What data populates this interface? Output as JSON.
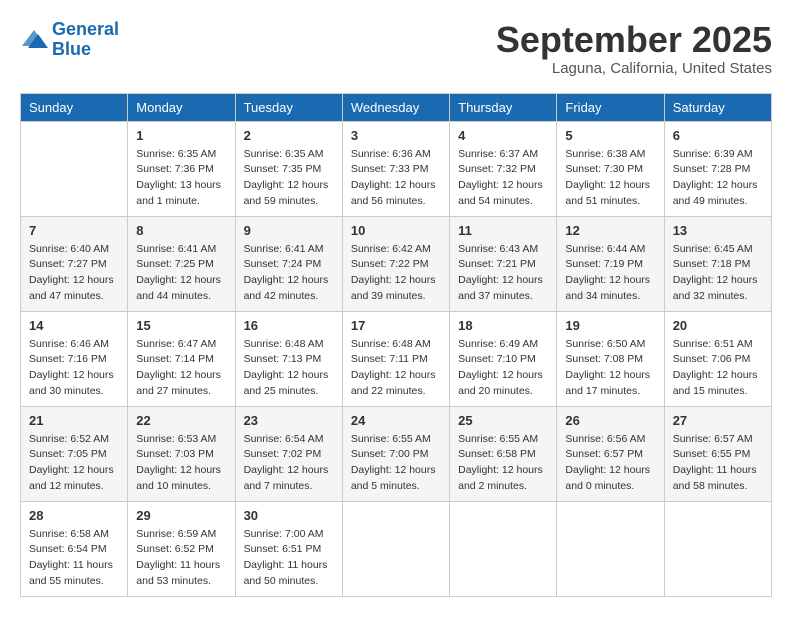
{
  "header": {
    "logo_line1": "General",
    "logo_line2": "Blue",
    "month_title": "September 2025",
    "location": "Laguna, California, United States"
  },
  "days_of_week": [
    "Sunday",
    "Monday",
    "Tuesday",
    "Wednesday",
    "Thursday",
    "Friday",
    "Saturday"
  ],
  "weeks": [
    [
      {
        "day": "",
        "sunrise": "",
        "sunset": "",
        "daylight": ""
      },
      {
        "day": "1",
        "sunrise": "Sunrise: 6:35 AM",
        "sunset": "Sunset: 7:36 PM",
        "daylight": "Daylight: 13 hours and 1 minute."
      },
      {
        "day": "2",
        "sunrise": "Sunrise: 6:35 AM",
        "sunset": "Sunset: 7:35 PM",
        "daylight": "Daylight: 12 hours and 59 minutes."
      },
      {
        "day": "3",
        "sunrise": "Sunrise: 6:36 AM",
        "sunset": "Sunset: 7:33 PM",
        "daylight": "Daylight: 12 hours and 56 minutes."
      },
      {
        "day": "4",
        "sunrise": "Sunrise: 6:37 AM",
        "sunset": "Sunset: 7:32 PM",
        "daylight": "Daylight: 12 hours and 54 minutes."
      },
      {
        "day": "5",
        "sunrise": "Sunrise: 6:38 AM",
        "sunset": "Sunset: 7:30 PM",
        "daylight": "Daylight: 12 hours and 51 minutes."
      },
      {
        "day": "6",
        "sunrise": "Sunrise: 6:39 AM",
        "sunset": "Sunset: 7:28 PM",
        "daylight": "Daylight: 12 hours and 49 minutes."
      }
    ],
    [
      {
        "day": "7",
        "sunrise": "Sunrise: 6:40 AM",
        "sunset": "Sunset: 7:27 PM",
        "daylight": "Daylight: 12 hours and 47 minutes."
      },
      {
        "day": "8",
        "sunrise": "Sunrise: 6:41 AM",
        "sunset": "Sunset: 7:25 PM",
        "daylight": "Daylight: 12 hours and 44 minutes."
      },
      {
        "day": "9",
        "sunrise": "Sunrise: 6:41 AM",
        "sunset": "Sunset: 7:24 PM",
        "daylight": "Daylight: 12 hours and 42 minutes."
      },
      {
        "day": "10",
        "sunrise": "Sunrise: 6:42 AM",
        "sunset": "Sunset: 7:22 PM",
        "daylight": "Daylight: 12 hours and 39 minutes."
      },
      {
        "day": "11",
        "sunrise": "Sunrise: 6:43 AM",
        "sunset": "Sunset: 7:21 PM",
        "daylight": "Daylight: 12 hours and 37 minutes."
      },
      {
        "day": "12",
        "sunrise": "Sunrise: 6:44 AM",
        "sunset": "Sunset: 7:19 PM",
        "daylight": "Daylight: 12 hours and 34 minutes."
      },
      {
        "day": "13",
        "sunrise": "Sunrise: 6:45 AM",
        "sunset": "Sunset: 7:18 PM",
        "daylight": "Daylight: 12 hours and 32 minutes."
      }
    ],
    [
      {
        "day": "14",
        "sunrise": "Sunrise: 6:46 AM",
        "sunset": "Sunset: 7:16 PM",
        "daylight": "Daylight: 12 hours and 30 minutes."
      },
      {
        "day": "15",
        "sunrise": "Sunrise: 6:47 AM",
        "sunset": "Sunset: 7:14 PM",
        "daylight": "Daylight: 12 hours and 27 minutes."
      },
      {
        "day": "16",
        "sunrise": "Sunrise: 6:48 AM",
        "sunset": "Sunset: 7:13 PM",
        "daylight": "Daylight: 12 hours and 25 minutes."
      },
      {
        "day": "17",
        "sunrise": "Sunrise: 6:48 AM",
        "sunset": "Sunset: 7:11 PM",
        "daylight": "Daylight: 12 hours and 22 minutes."
      },
      {
        "day": "18",
        "sunrise": "Sunrise: 6:49 AM",
        "sunset": "Sunset: 7:10 PM",
        "daylight": "Daylight: 12 hours and 20 minutes."
      },
      {
        "day": "19",
        "sunrise": "Sunrise: 6:50 AM",
        "sunset": "Sunset: 7:08 PM",
        "daylight": "Daylight: 12 hours and 17 minutes."
      },
      {
        "day": "20",
        "sunrise": "Sunrise: 6:51 AM",
        "sunset": "Sunset: 7:06 PM",
        "daylight": "Daylight: 12 hours and 15 minutes."
      }
    ],
    [
      {
        "day": "21",
        "sunrise": "Sunrise: 6:52 AM",
        "sunset": "Sunset: 7:05 PM",
        "daylight": "Daylight: 12 hours and 12 minutes."
      },
      {
        "day": "22",
        "sunrise": "Sunrise: 6:53 AM",
        "sunset": "Sunset: 7:03 PM",
        "daylight": "Daylight: 12 hours and 10 minutes."
      },
      {
        "day": "23",
        "sunrise": "Sunrise: 6:54 AM",
        "sunset": "Sunset: 7:02 PM",
        "daylight": "Daylight: 12 hours and 7 minutes."
      },
      {
        "day": "24",
        "sunrise": "Sunrise: 6:55 AM",
        "sunset": "Sunset: 7:00 PM",
        "daylight": "Daylight: 12 hours and 5 minutes."
      },
      {
        "day": "25",
        "sunrise": "Sunrise: 6:55 AM",
        "sunset": "Sunset: 6:58 PM",
        "daylight": "Daylight: 12 hours and 2 minutes."
      },
      {
        "day": "26",
        "sunrise": "Sunrise: 6:56 AM",
        "sunset": "Sunset: 6:57 PM",
        "daylight": "Daylight: 12 hours and 0 minutes."
      },
      {
        "day": "27",
        "sunrise": "Sunrise: 6:57 AM",
        "sunset": "Sunset: 6:55 PM",
        "daylight": "Daylight: 11 hours and 58 minutes."
      }
    ],
    [
      {
        "day": "28",
        "sunrise": "Sunrise: 6:58 AM",
        "sunset": "Sunset: 6:54 PM",
        "daylight": "Daylight: 11 hours and 55 minutes."
      },
      {
        "day": "29",
        "sunrise": "Sunrise: 6:59 AM",
        "sunset": "Sunset: 6:52 PM",
        "daylight": "Daylight: 11 hours and 53 minutes."
      },
      {
        "day": "30",
        "sunrise": "Sunrise: 7:00 AM",
        "sunset": "Sunset: 6:51 PM",
        "daylight": "Daylight: 11 hours and 50 minutes."
      },
      {
        "day": "",
        "sunrise": "",
        "sunset": "",
        "daylight": ""
      },
      {
        "day": "",
        "sunrise": "",
        "sunset": "",
        "daylight": ""
      },
      {
        "day": "",
        "sunrise": "",
        "sunset": "",
        "daylight": ""
      },
      {
        "day": "",
        "sunrise": "",
        "sunset": "",
        "daylight": ""
      }
    ]
  ]
}
